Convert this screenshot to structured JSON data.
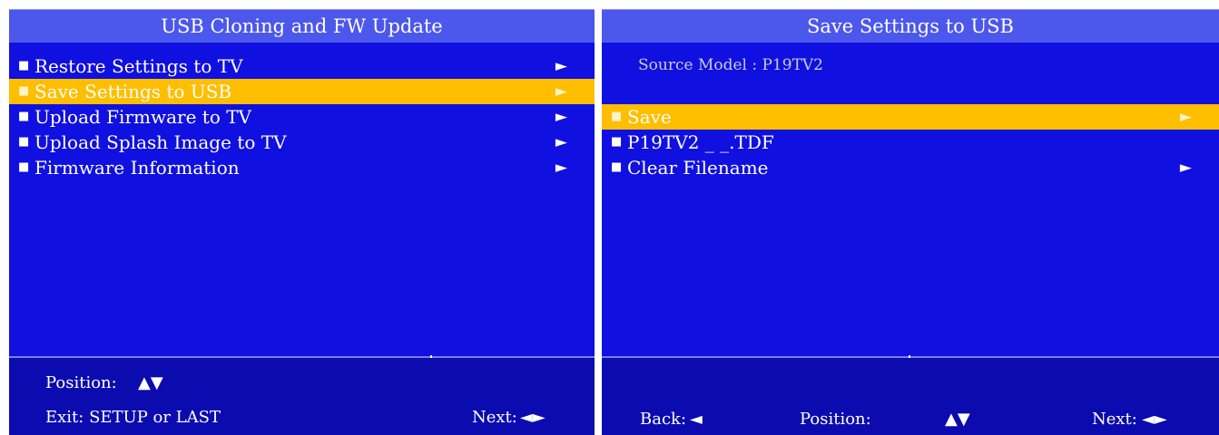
{
  "left": {
    "title": "USB Cloning and FW Update",
    "items": [
      {
        "bullet": "■",
        "label": "Restore Settings to TV",
        "arrow": "►"
      },
      {
        "bullet": "■",
        "label": "Save Settings to USB",
        "arrow": "►"
      },
      {
        "bullet": "■",
        "label": "Upload Firmware to TV",
        "arrow": "►"
      },
      {
        "bullet": "■",
        "label": "Upload Splash Image to TV",
        "arrow": "►"
      },
      {
        "bullet": "■",
        "label": "Firmware Information",
        "arrow": "►"
      }
    ],
    "selected_index": 1,
    "footer": {
      "position_label": "Position:",
      "position_keys": "▲▼",
      "exit_text": "Exit: SETUP or LAST",
      "next_label": "Next:",
      "next_keys": "◄►"
    }
  },
  "right": {
    "title": "Save Settings to USB",
    "source_model": "Source Model : P19TV2",
    "items": [
      {
        "bullet": "■",
        "label": "Save",
        "arrow": "►"
      },
      {
        "bullet": "■",
        "label": "P19TV2 _ _.TDF",
        "arrow": ""
      },
      {
        "bullet": "■",
        "label": "Clear Filename",
        "arrow": "►"
      }
    ],
    "selected_index": 0,
    "footer": {
      "back_label": "Back:",
      "back_key": "◄",
      "position_label": "Position:",
      "position_keys": "▲▼",
      "next_label": "Next:",
      "next_keys": "◄►"
    }
  },
  "colors": {
    "panel_bg": "#1010e0",
    "title_bg": "#4c57ec",
    "selected_bg": "#ffbe00",
    "footer_bg": "#0b0bb0"
  }
}
